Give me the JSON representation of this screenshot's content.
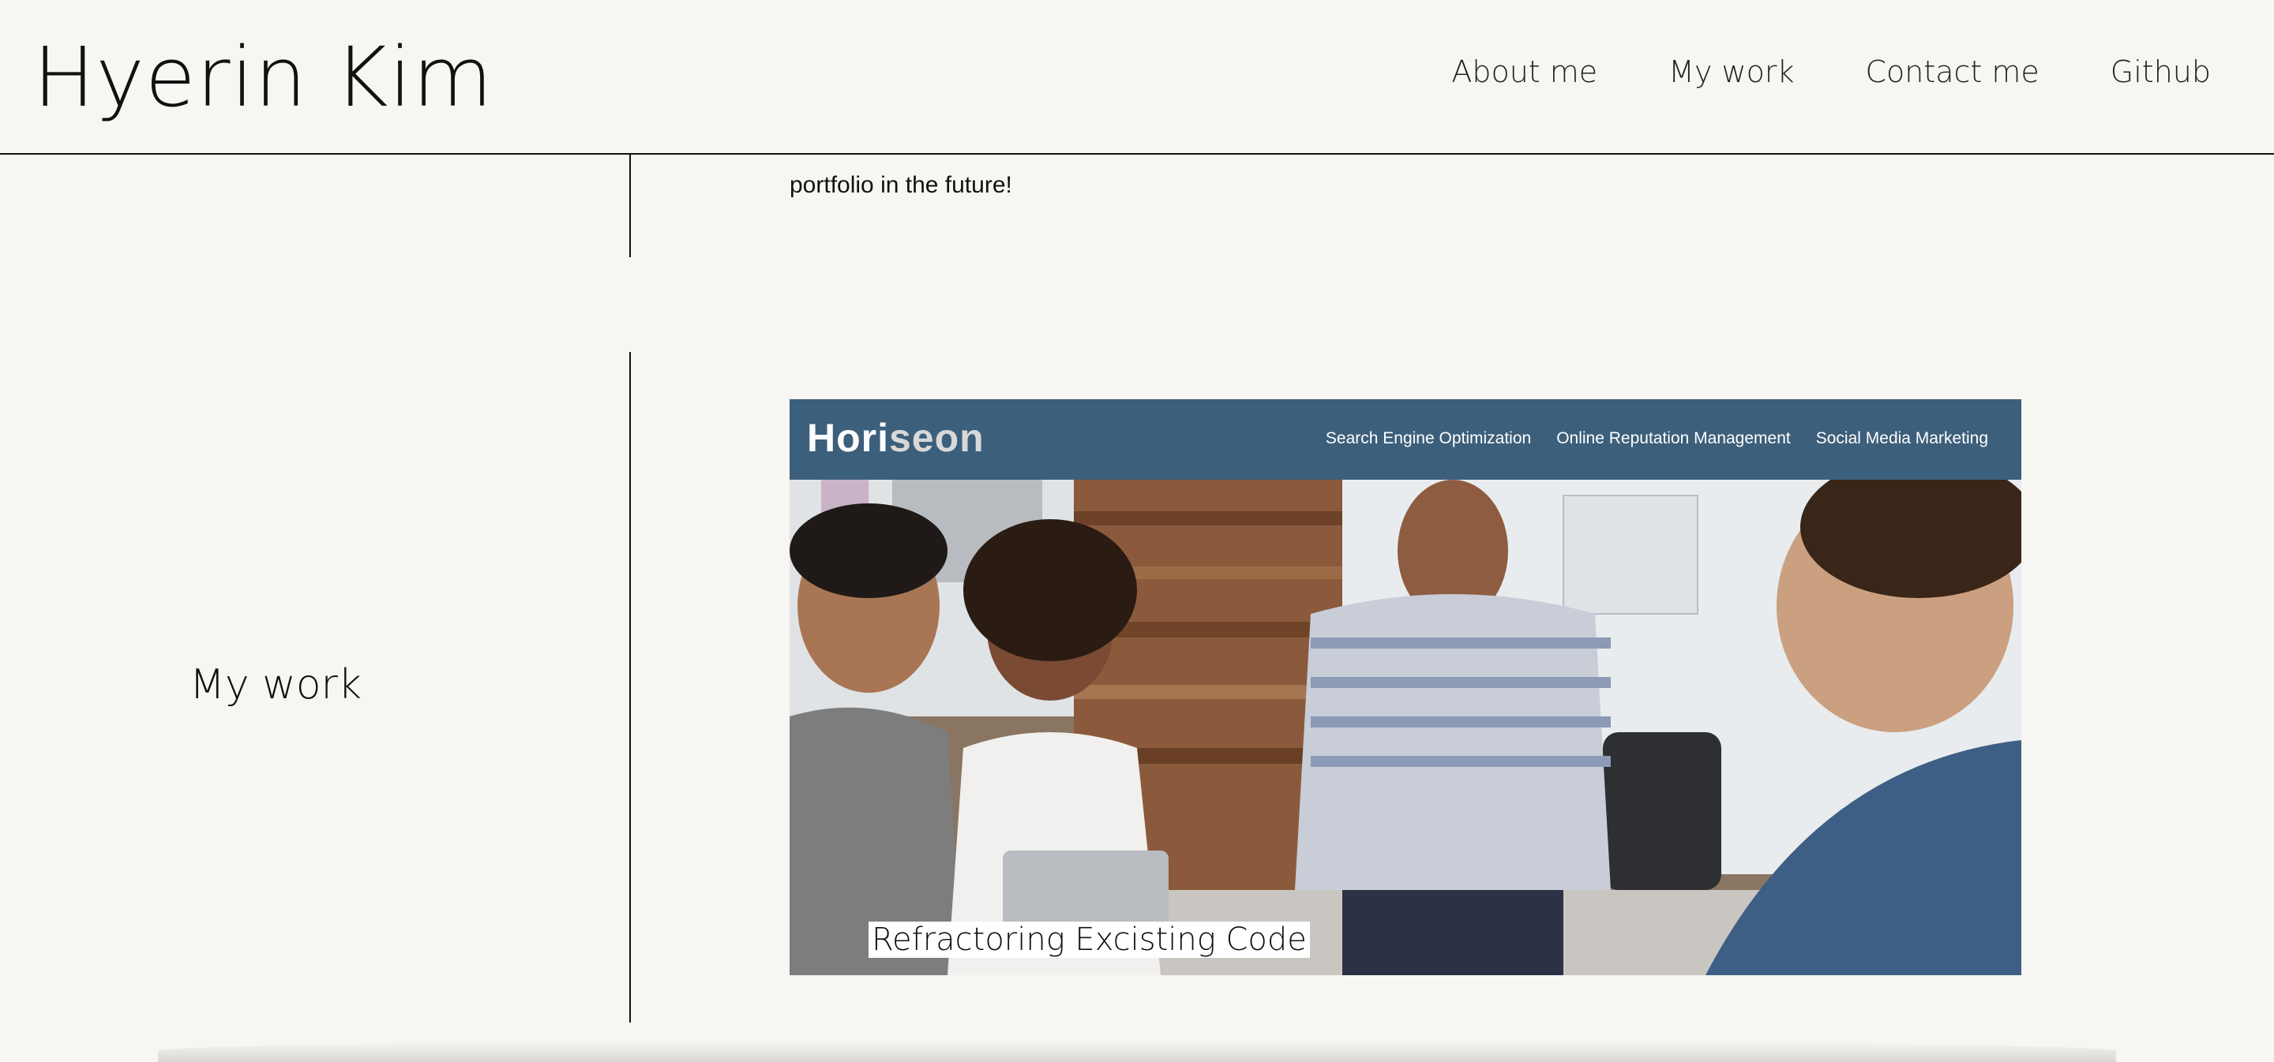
{
  "header": {
    "site_title": "Hyerin Kim",
    "nav": [
      {
        "label": "About me"
      },
      {
        "label": "My work"
      },
      {
        "label": "Contact me"
      },
      {
        "label": "Github"
      }
    ]
  },
  "about": {
    "tail_text": "portfolio in the future!"
  },
  "work": {
    "heading": "My work",
    "project": {
      "logo_bold": "Hori",
      "logo_light": "seon",
      "nav": [
        "Search Engine Optimization",
        "Online Reputation Management",
        "Social Media Marketing"
      ],
      "caption": "Refractoring Excisting Code"
    }
  },
  "colors": {
    "background": "#f7f6f2",
    "project_bar": "#3c5f7b"
  }
}
